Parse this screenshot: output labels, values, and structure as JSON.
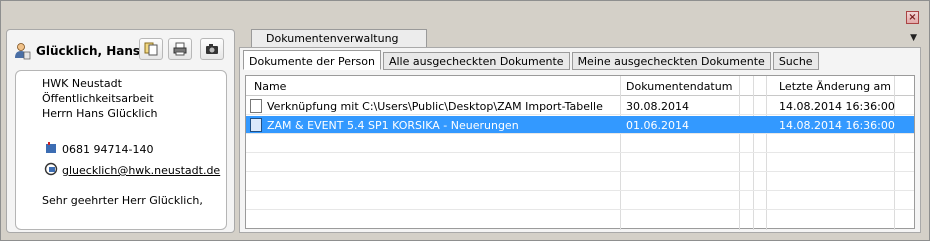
{
  "window": {
    "close_icon": "close-icon",
    "menu_icon": "chevron-down-icon"
  },
  "contact": {
    "name": "Glücklich, Hans",
    "toolbar": [
      "copy-icon",
      "print-icon",
      "camera-icon"
    ],
    "card": {
      "organization": "HWK Neustadt",
      "department": "Öffentlichkeitsarbeit",
      "salutation_name": "Herrn Hans Glücklich",
      "phone": "0681 94714-140",
      "email": "gluecklich@hwk.neustadt.de",
      "greeting": "Sehr geehrter Herr Glücklich,"
    }
  },
  "documents": {
    "title_tab": "Dokumentenverwaltung",
    "subtabs": [
      "Dokumente der Person",
      "Alle ausgecheckten Dokumente",
      "Meine ausgecheckten Dokumente",
      "Suche"
    ],
    "active_subtab": 0,
    "columns": [
      "Name",
      "Dokumentendatum",
      "Letzte Änderung am"
    ],
    "rows": [
      {
        "name": "Verknüpfung mit C:\\Users\\Public\\Desktop\\ZAM Import-Tabelle",
        "date": "30.08.2014",
        "modified": "14.08.2014 16:36:00",
        "selected": false,
        "icon": "shortcut-document-icon"
      },
      {
        "name": "ZAM & EVENT 5.4 SP1 KORSIKA - Neuerungen",
        "date": "01.06.2014",
        "modified": "14.08.2014 16:36:00",
        "selected": true,
        "icon": "document-icon"
      }
    ]
  },
  "colors": {
    "selection": "#3399ff",
    "window_bg": "#d4d0c8"
  }
}
